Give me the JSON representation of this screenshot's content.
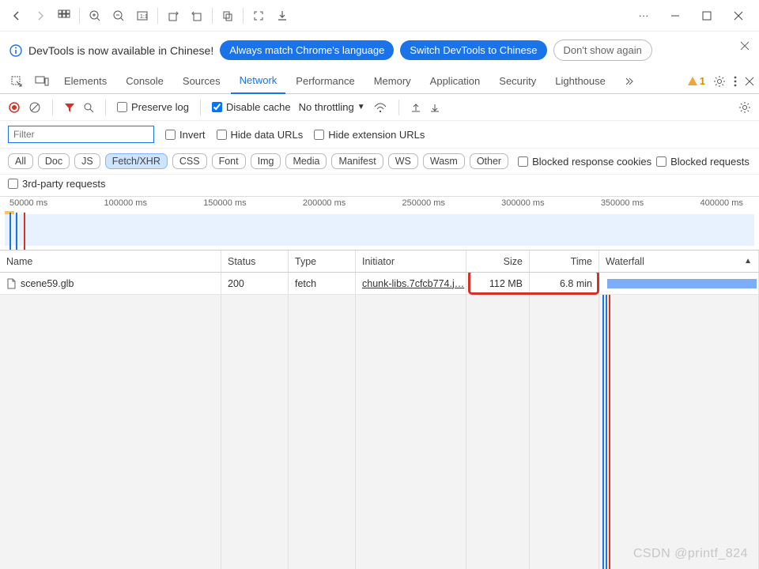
{
  "infobar": {
    "message": "DevTools is now available in Chinese!",
    "btn_match": "Always match Chrome's language",
    "btn_switch": "Switch DevTools to Chinese",
    "btn_dismiss": "Don't show again"
  },
  "tabs": {
    "elements": "Elements",
    "console": "Console",
    "sources": "Sources",
    "network": "Network",
    "performance": "Performance",
    "memory": "Memory",
    "application": "Application",
    "security": "Security",
    "lighthouse": "Lighthouse",
    "warn_count": "1"
  },
  "toolbar": {
    "preserve_log": "Preserve log",
    "disable_cache": "Disable cache",
    "throttling": "No throttling"
  },
  "filter": {
    "placeholder": "Filter",
    "invert": "Invert",
    "hide_data": "Hide data URLs",
    "hide_ext": "Hide extension URLs"
  },
  "chips": {
    "all": "All",
    "doc": "Doc",
    "js": "JS",
    "fetch": "Fetch/XHR",
    "css": "CSS",
    "font": "Font",
    "img": "Img",
    "media": "Media",
    "manifest": "Manifest",
    "ws": "WS",
    "wasm": "Wasm",
    "other": "Other",
    "blocked_cookies": "Blocked response cookies",
    "blocked_req": "Blocked requests",
    "third_party": "3rd-party requests"
  },
  "timeline_ticks": [
    "50000 ms",
    "100000 ms",
    "150000 ms",
    "200000 ms",
    "250000 ms",
    "300000 ms",
    "350000 ms",
    "400000 ms"
  ],
  "columns": {
    "name": "Name",
    "status": "Status",
    "type": "Type",
    "initiator": "Initiator",
    "size": "Size",
    "time": "Time",
    "waterfall": "Waterfall"
  },
  "rows": [
    {
      "name": "scene59.glb",
      "status": "200",
      "type": "fetch",
      "initiator": "chunk-libs.7cfcb774.j…",
      "size": "112 MB",
      "time": "6.8 min"
    }
  ],
  "watermark": "CSDN @printf_824"
}
